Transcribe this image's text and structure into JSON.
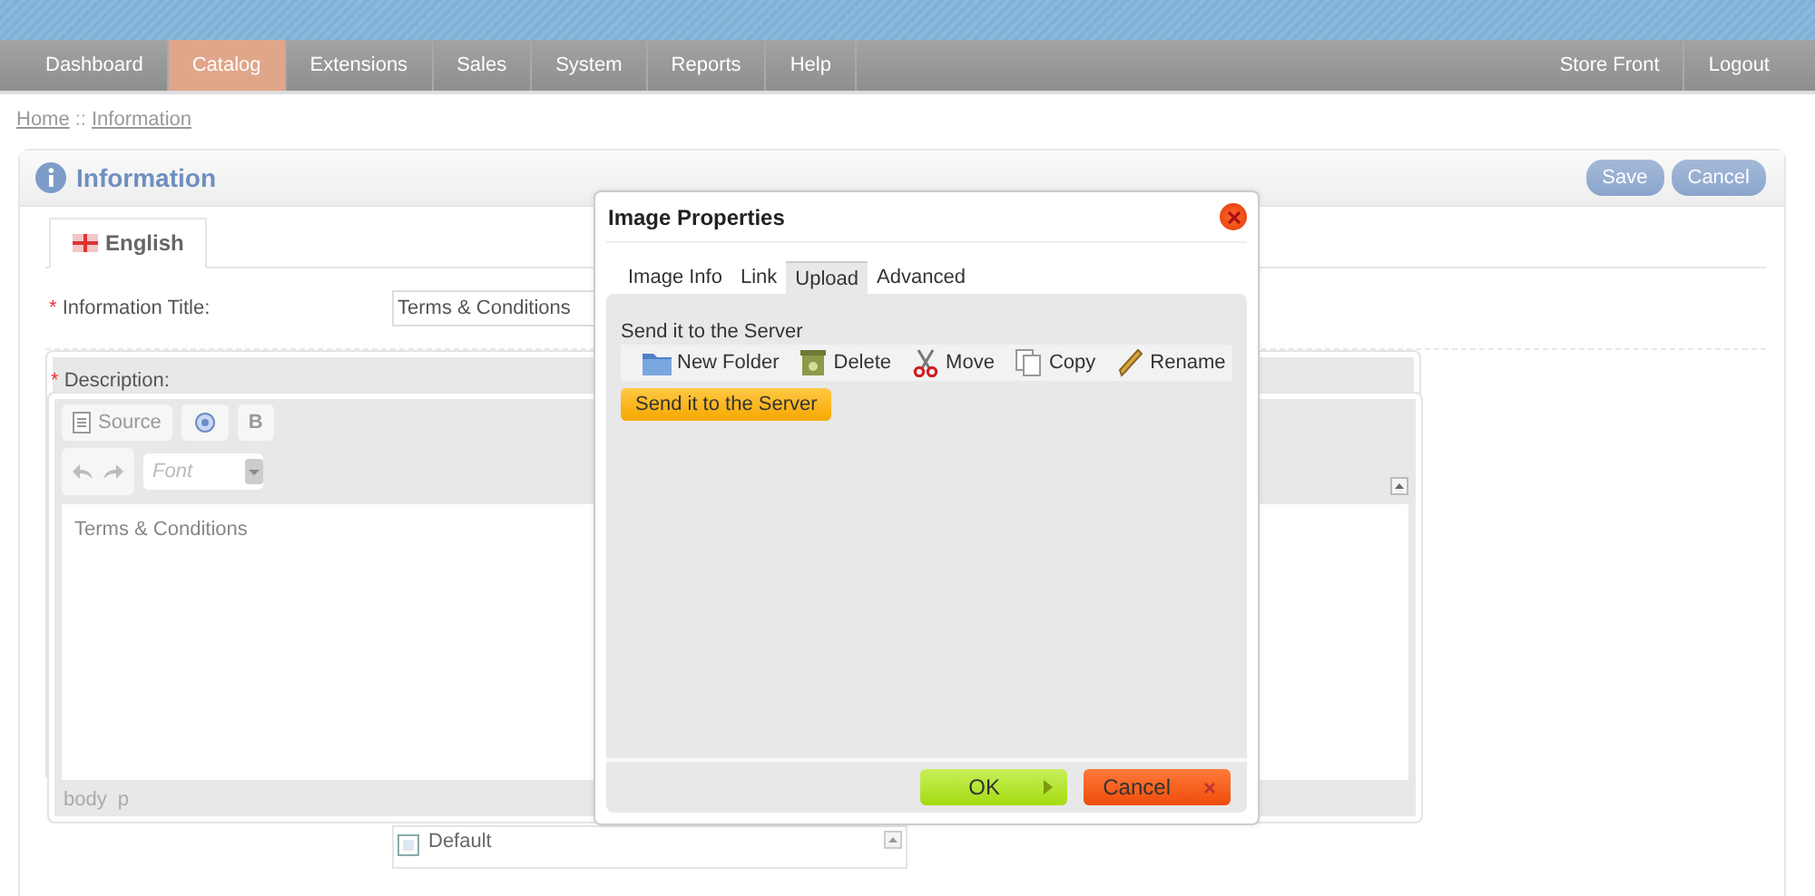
{
  "nav": {
    "left": [
      {
        "label": "Dashboard",
        "selected": false
      },
      {
        "label": "Catalog",
        "selected": true
      },
      {
        "label": "Extensions",
        "selected": false
      },
      {
        "label": "Sales",
        "selected": false
      },
      {
        "label": "System",
        "selected": false
      },
      {
        "label": "Reports",
        "selected": false
      },
      {
        "label": "Help",
        "selected": false
      }
    ],
    "right": [
      "Store Front",
      "Logout"
    ]
  },
  "breadcrumb": [
    "Home",
    "Information"
  ],
  "breadcrumb_separator": "::",
  "panel": {
    "title": "Information",
    "buttons": [
      "Save",
      "Cancel"
    ],
    "language_tabs": [
      {
        "label": "English",
        "selected": true
      }
    ],
    "fields": [
      {
        "kind": "text",
        "label": "Information Title:",
        "required_mark": "*",
        "value": "Terms & Conditions"
      },
      {
        "kind": "editor",
        "label": "Description:",
        "required_mark": "*",
        "toolbar": {
          "source": "Source",
          "bold": "B",
          "font_placeholder": "Font"
        },
        "content": "Terms & Conditions",
        "path": [
          "body",
          "p"
        ]
      },
      {
        "kind": "checkbox",
        "label": "Default",
        "checked": true
      }
    ]
  },
  "dialog": {
    "title": "Image Properties",
    "tabs": [
      {
        "label": "Image Info",
        "selected": false
      },
      {
        "label": "Link",
        "selected": false
      },
      {
        "label": "Upload",
        "selected": true
      },
      {
        "label": "Advanced",
        "selected": false
      }
    ],
    "section_label": "Send it to the Server",
    "file_actions": [
      {
        "kind": "folder",
        "label": "New Folder"
      },
      {
        "kind": "trash",
        "label": "Delete"
      },
      {
        "kind": "scissors",
        "label": "Move"
      },
      {
        "kind": "copy",
        "label": "Copy"
      },
      {
        "kind": "pencil",
        "label": "Rename"
      }
    ],
    "send_button": "Send it to the Server",
    "ok": "OK",
    "cancel": "Cancel"
  }
}
